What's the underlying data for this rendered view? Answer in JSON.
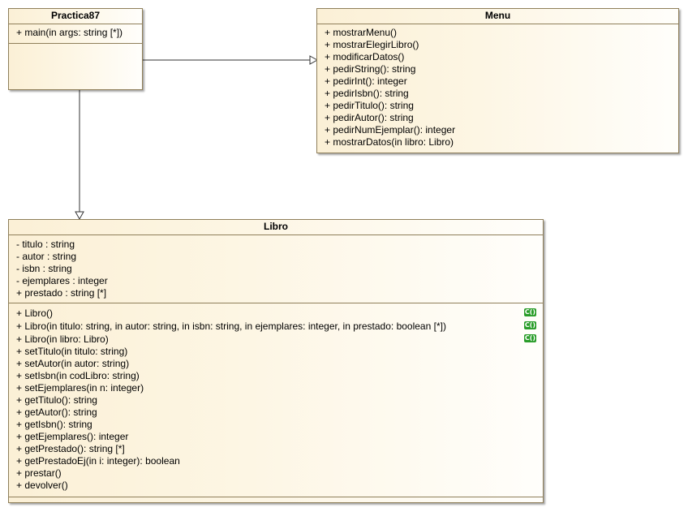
{
  "classes": {
    "practica87": {
      "name": "Practica87",
      "operations": [
        "+ main(in args: string [*])"
      ]
    },
    "menu": {
      "name": "Menu",
      "operations": [
        "+ mostrarMenu()",
        "+ mostrarElegirLibro()",
        "+ modificarDatos()",
        "+ pedirString(): string",
        "+ pedirInt(): integer",
        "+ pedirIsbn(): string",
        "+ pedirTitulo(): string",
        "+ pedirAutor(): string",
        "+ pedirNumEjemplar(): integer",
        "+ mostrarDatos(in libro: Libro)"
      ]
    },
    "libro": {
      "name": "Libro",
      "attributes": [
        "- titulo : string",
        "- autor : string",
        "- isbn : string",
        "- ejemplares : integer",
        "+ prestado : string [*]"
      ],
      "operations": [
        "+ Libro()",
        "+ Libro(in titulo: string, in autor: string, in isbn: string, in ejemplares: integer, in prestado: boolean [*])",
        "+ Libro(in libro: Libro)",
        "+ setTitulo(in titulo: string)",
        "+ setAutor(in autor: string)",
        "+ setIsbn(in codLibro: string)",
        "+ setEjemplares(in n: integer)",
        "+ getTitulo(): string",
        "+ getAutor(): string",
        "+ getIsbn(): string",
        "+ getEjemplares(): integer",
        "+ getPrestado(): string [*]",
        "+ getPrestadoEj(in i: integer): boolean",
        "+ prestar()",
        "+ devolver()"
      ],
      "constructor_badge": "C()"
    }
  },
  "colors": {
    "border": "#8f7f5a",
    "fill_start": "#fbf0d6",
    "constructor_badge": "#2a9d2a"
  }
}
